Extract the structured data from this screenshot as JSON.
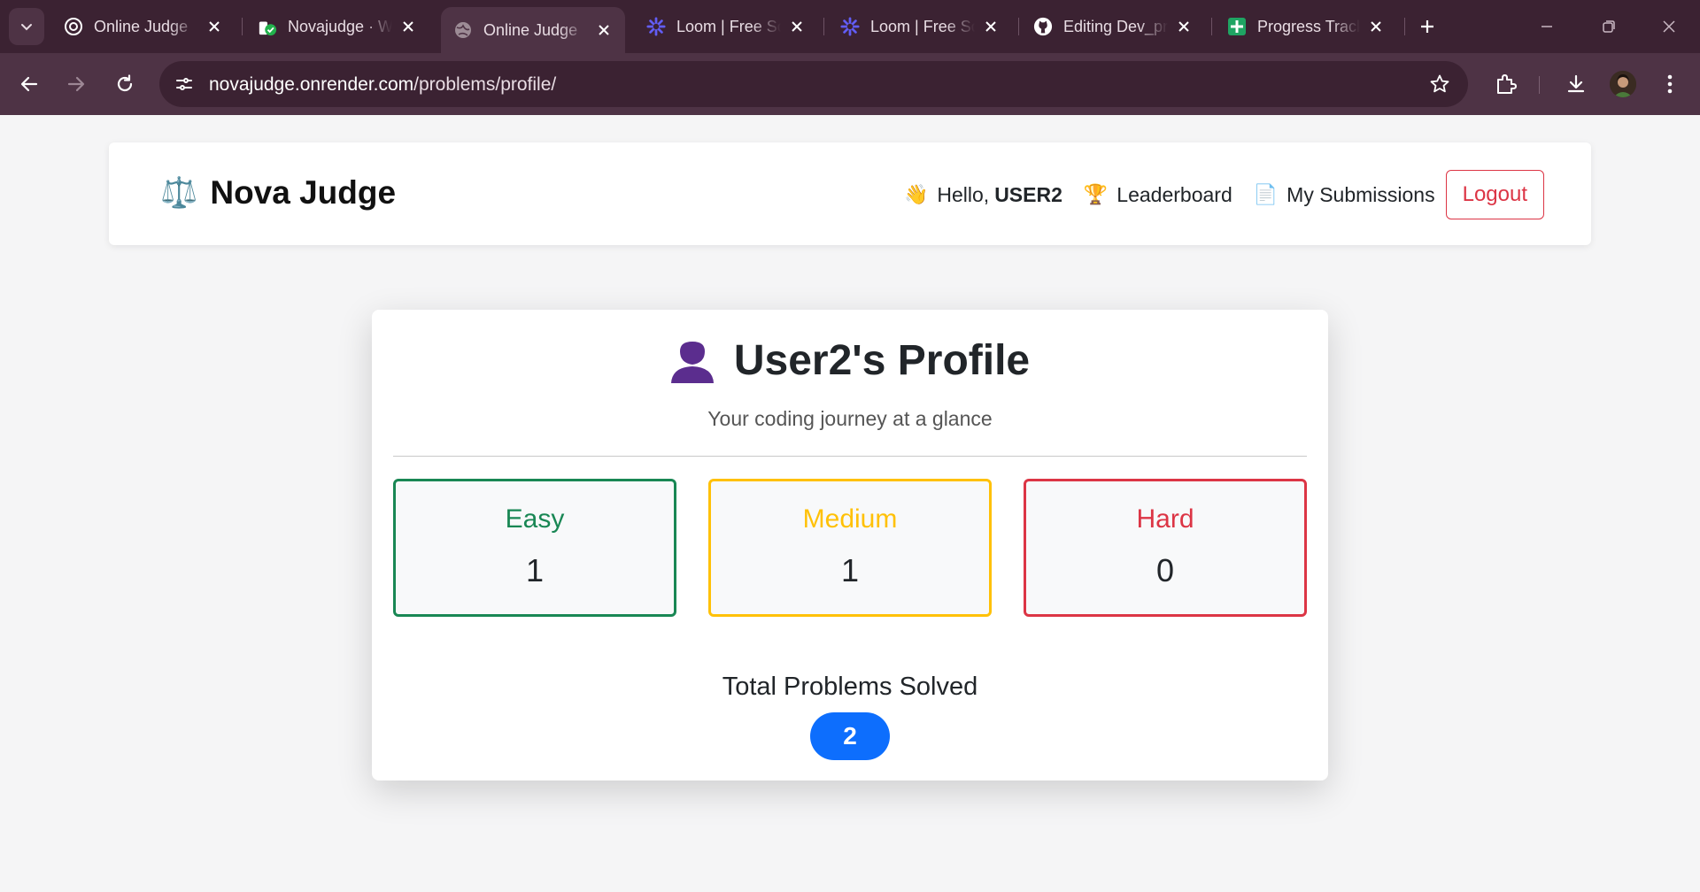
{
  "browser": {
    "tabs": [
      {
        "title": "Online Judge",
        "icon": "openai-icon"
      },
      {
        "title": "Novajudge · Web",
        "icon": "render-icon"
      },
      {
        "title": "Online Judge",
        "icon": "globe-icon",
        "active": true
      },
      {
        "title": "Loom | Free Screen",
        "icon": "loom-icon"
      },
      {
        "title": "Loom | Free Screen",
        "icon": "loom-icon"
      },
      {
        "title": "Editing Dev_prep",
        "icon": "github-icon"
      },
      {
        "title": "Progress Tracker",
        "icon": "sheets-icon"
      }
    ],
    "url_host": "novajudge.onrender.com",
    "url_path": "/problems/profile/"
  },
  "navbar": {
    "brand_emoji": "⚖️",
    "brand_name": "Nova Judge",
    "greeting_emoji": "👋",
    "greeting": "Hello,",
    "username": "USER2",
    "leaderboard_emoji": "🏆",
    "leaderboard_label": "Leaderboard",
    "submissions_emoji": "📄",
    "submissions_label": "My Submissions",
    "logout_label": "Logout"
  },
  "profile": {
    "title": "User2's Profile",
    "subtitle": "Your coding journey at a glance",
    "stats": {
      "easy": {
        "label": "Easy",
        "count": "1",
        "color": "#198754"
      },
      "medium": {
        "label": "Medium",
        "count": "1",
        "color": "#ffc107"
      },
      "hard": {
        "label": "Hard",
        "count": "0",
        "color": "#dc3545"
      }
    },
    "total_label": "Total Problems Solved",
    "total_count": "2",
    "accent": "#0d6efd"
  }
}
